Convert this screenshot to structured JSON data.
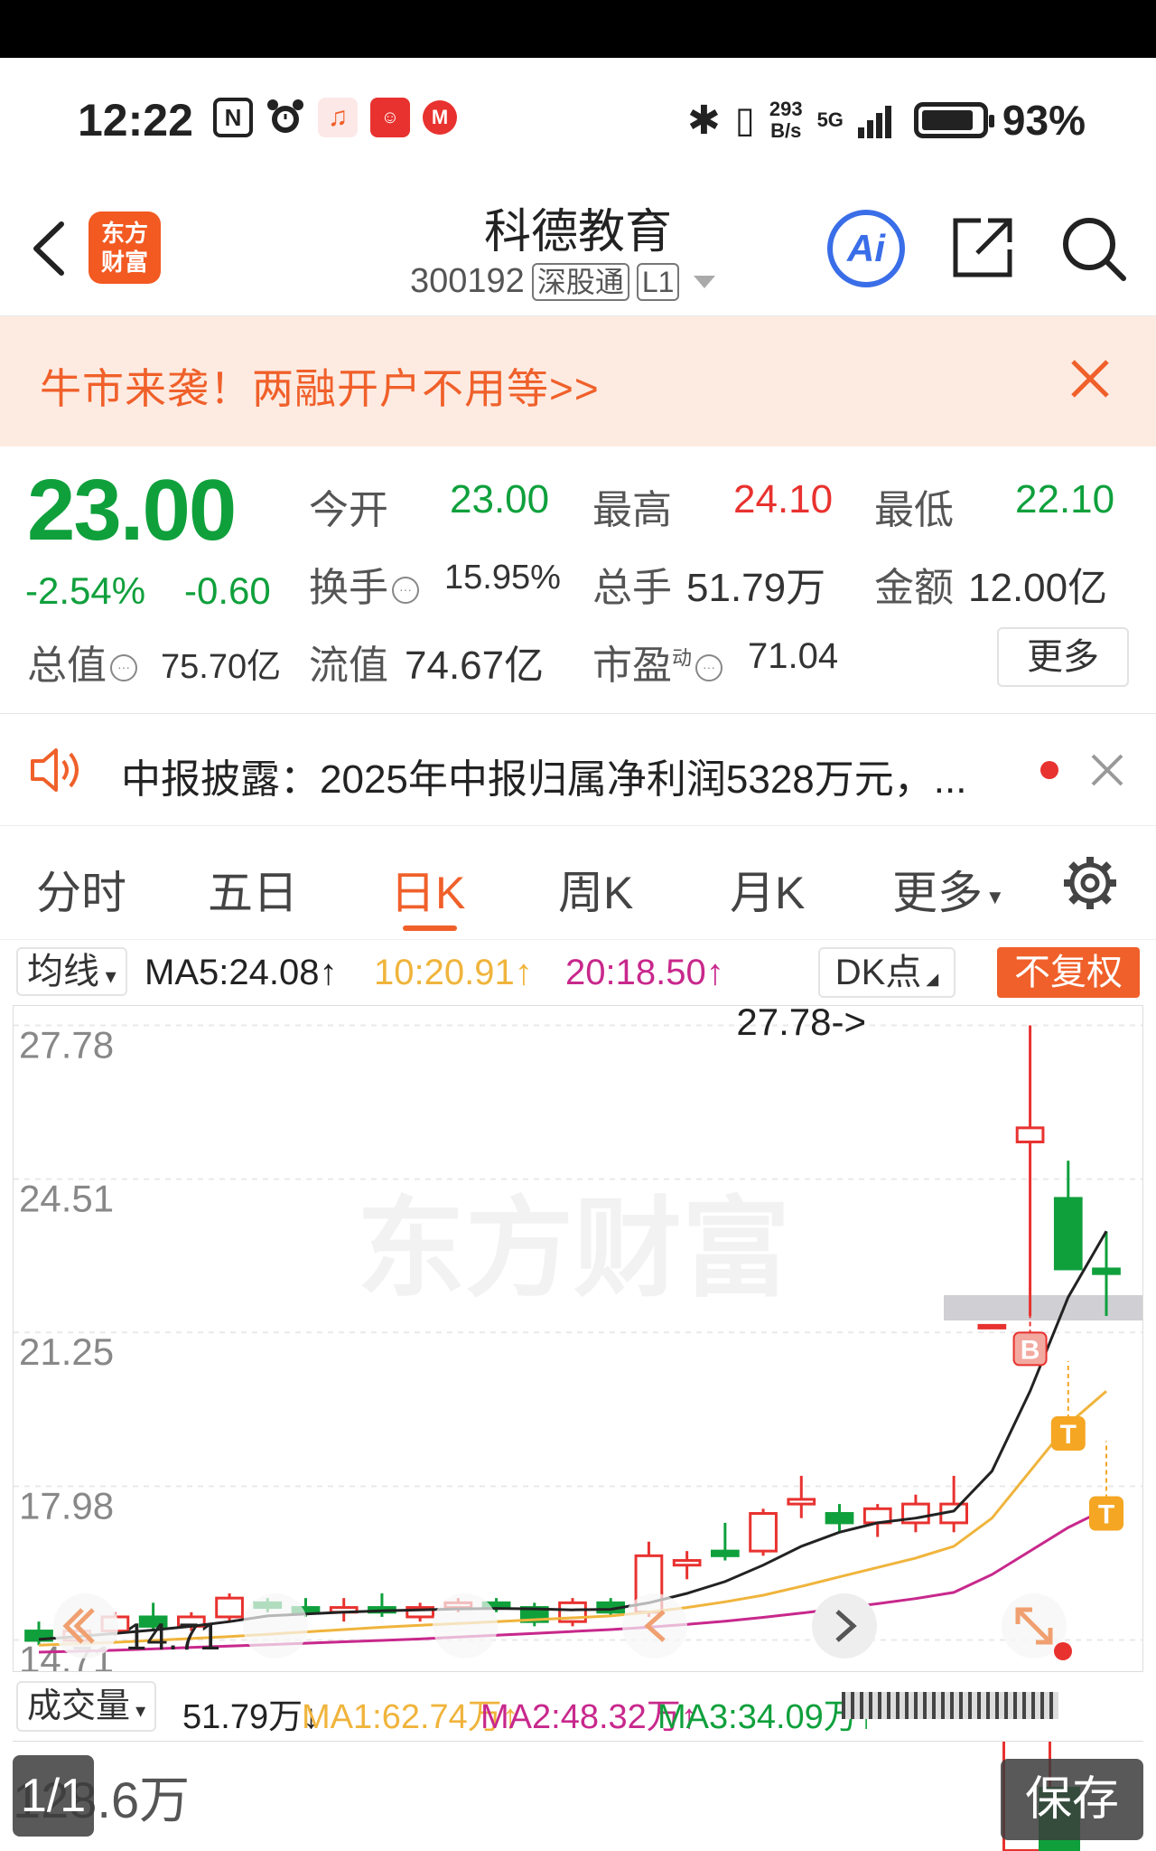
{
  "status_bar": {
    "time": "12:22",
    "net_speed_top": "293",
    "net_speed_bottom": "B/s",
    "network": "5G",
    "battery": "93%"
  },
  "header": {
    "brand_line1": "东方",
    "brand_line2": "财富",
    "stock_name": "科德教育",
    "stock_code": "300192",
    "tag1": "深股通",
    "tag2": "L1",
    "ai_label": "Ai"
  },
  "promo": {
    "text": "牛市来袭！两融开户不用等>>"
  },
  "quote": {
    "price": "23.00",
    "change_pct": "-2.54%",
    "change_abs": "-0.60",
    "open_label": "今开",
    "open_value": "23.00",
    "high_label": "最高",
    "high_value": "24.10",
    "low_label": "最低",
    "low_value": "22.10",
    "turnover_label": "换手",
    "turnover_value": "15.95%",
    "volume_label": "总手",
    "volume_value": "51.79万",
    "amount_label": "金额",
    "amount_value": "12.00亿",
    "mktcap_label": "总值",
    "mktcap_value": "75.70亿",
    "float_label": "流值",
    "float_value": "74.67亿",
    "pe_label": "市盈",
    "pe_sup": "动",
    "pe_value": "71.04",
    "more_label": "更多"
  },
  "news": {
    "text": "中报披露：2025年中报归属净利润5328万元，..."
  },
  "tabs": [
    "分时",
    "五日",
    "日K",
    "周K",
    "月K",
    "更多"
  ],
  "ma_row": {
    "avg_label": "均线",
    "ma5": "MA5:24.08↑",
    "ma10": "10:20.91↑",
    "ma20": "20:18.50↑",
    "dk_label": "DK点",
    "fq_label": "不复权"
  },
  "colors": {
    "up": "#e8322f",
    "down": "#0fa03c",
    "ma5": "#222222",
    "ma10": "#f0b43c",
    "ma20": "#c8288c",
    "accent": "#f0602a"
  },
  "chart_data": {
    "type": "candlestick",
    "y_ticks": [
      "27.78",
      "24.51",
      "21.25",
      "17.98",
      "14.71"
    ],
    "ylim": [
      14.2,
      28.0
    ],
    "max_label": "27.78->",
    "min_label": "14.71",
    "watermark": "东方财富",
    "markers": [
      "B",
      "T",
      "T"
    ],
    "candles": [
      {
        "o": 14.9,
        "h": 15.1,
        "l": 14.6,
        "c": 14.7
      },
      {
        "o": 14.7,
        "h": 15.0,
        "l": 14.6,
        "c": 14.9
      },
      {
        "o": 14.9,
        "h": 15.3,
        "l": 14.8,
        "c": 15.2
      },
      {
        "o": 15.2,
        "h": 15.5,
        "l": 14.9,
        "c": 15.0
      },
      {
        "o": 15.0,
        "h": 15.3,
        "l": 14.9,
        "c": 15.2
      },
      {
        "o": 15.2,
        "h": 15.7,
        "l": 15.1,
        "c": 15.6
      },
      {
        "o": 15.5,
        "h": 15.6,
        "l": 15.3,
        "c": 15.4
      },
      {
        "o": 15.4,
        "h": 15.6,
        "l": 15.2,
        "c": 15.3
      },
      {
        "o": 15.3,
        "h": 15.6,
        "l": 15.1,
        "c": 15.4
      },
      {
        "o": 15.4,
        "h": 15.7,
        "l": 15.2,
        "c": 15.3
      },
      {
        "o": 15.2,
        "h": 15.5,
        "l": 15.1,
        "c": 15.4
      },
      {
        "o": 15.4,
        "h": 15.6,
        "l": 15.3,
        "c": 15.5
      },
      {
        "o": 15.5,
        "h": 15.6,
        "l": 15.3,
        "c": 15.4
      },
      {
        "o": 15.4,
        "h": 15.5,
        "l": 15.0,
        "c": 15.1
      },
      {
        "o": 15.1,
        "h": 15.6,
        "l": 15.0,
        "c": 15.5
      },
      {
        "o": 15.5,
        "h": 15.6,
        "l": 15.2,
        "c": 15.3
      },
      {
        "o": 15.3,
        "h": 16.8,
        "l": 15.2,
        "c": 16.5
      },
      {
        "o": 16.3,
        "h": 16.6,
        "l": 16.0,
        "c": 16.4
      },
      {
        "o": 16.6,
        "h": 17.2,
        "l": 16.4,
        "c": 16.5
      },
      {
        "o": 16.6,
        "h": 17.5,
        "l": 16.5,
        "c": 17.4
      },
      {
        "o": 17.6,
        "h": 18.2,
        "l": 17.3,
        "c": 17.7
      },
      {
        "o": 17.4,
        "h": 17.6,
        "l": 17.0,
        "c": 17.2
      },
      {
        "o": 17.2,
        "h": 17.6,
        "l": 16.9,
        "c": 17.5
      },
      {
        "o": 17.2,
        "h": 17.8,
        "l": 17.0,
        "c": 17.6
      },
      {
        "o": 17.2,
        "h": 18.2,
        "l": 17.0,
        "c": 17.6
      },
      {
        "o": 21.4,
        "h": 21.4,
        "l": 21.4,
        "c": 21.4
      },
      {
        "o": 25.3,
        "h": 27.78,
        "l": 21.6,
        "c": 25.6
      },
      {
        "o": 24.1,
        "h": 24.9,
        "l": 22.9,
        "c": 22.6
      },
      {
        "o": 22.6,
        "h": 23.4,
        "l": 21.6,
        "c": 22.5
      }
    ],
    "ma5": [
      14.72,
      14.78,
      14.85,
      14.92,
      15.0,
      15.1,
      15.22,
      15.26,
      15.3,
      15.33,
      15.35,
      15.37,
      15.38,
      15.37,
      15.35,
      15.36,
      15.5,
      15.7,
      15.95,
      16.3,
      16.7,
      17.0,
      17.2,
      17.3,
      17.45,
      18.3,
      20.0,
      22.0,
      23.4
    ],
    "ma10": [
      14.6,
      14.63,
      14.66,
      14.7,
      14.74,
      14.78,
      14.83,
      14.88,
      14.93,
      14.98,
      15.02,
      15.06,
      15.1,
      15.14,
      15.18,
      15.22,
      15.3,
      15.4,
      15.52,
      15.66,
      15.85,
      16.05,
      16.25,
      16.45,
      16.7,
      17.3,
      18.3,
      19.3,
      20.0
    ],
    "ma20": [
      14.45,
      14.47,
      14.49,
      14.52,
      14.55,
      14.58,
      14.61,
      14.64,
      14.67,
      14.7,
      14.73,
      14.77,
      14.81,
      14.85,
      14.89,
      14.93,
      14.98,
      15.04,
      15.11,
      15.19,
      15.28,
      15.38,
      15.48,
      15.59,
      15.72,
      16.1,
      16.6,
      17.1,
      17.5
    ]
  },
  "volume_row": {
    "vol_label": "成交量",
    "vol_value": "51.79万↓",
    "ma1": "MA1:62.74万↑",
    "ma2": "MA2:48.32万↑",
    "ma3": "MA3:34.09万↑"
  },
  "volume_box": {
    "max_label": "128.6万",
    "page_indicator": "1/1",
    "save_label": "保存"
  }
}
